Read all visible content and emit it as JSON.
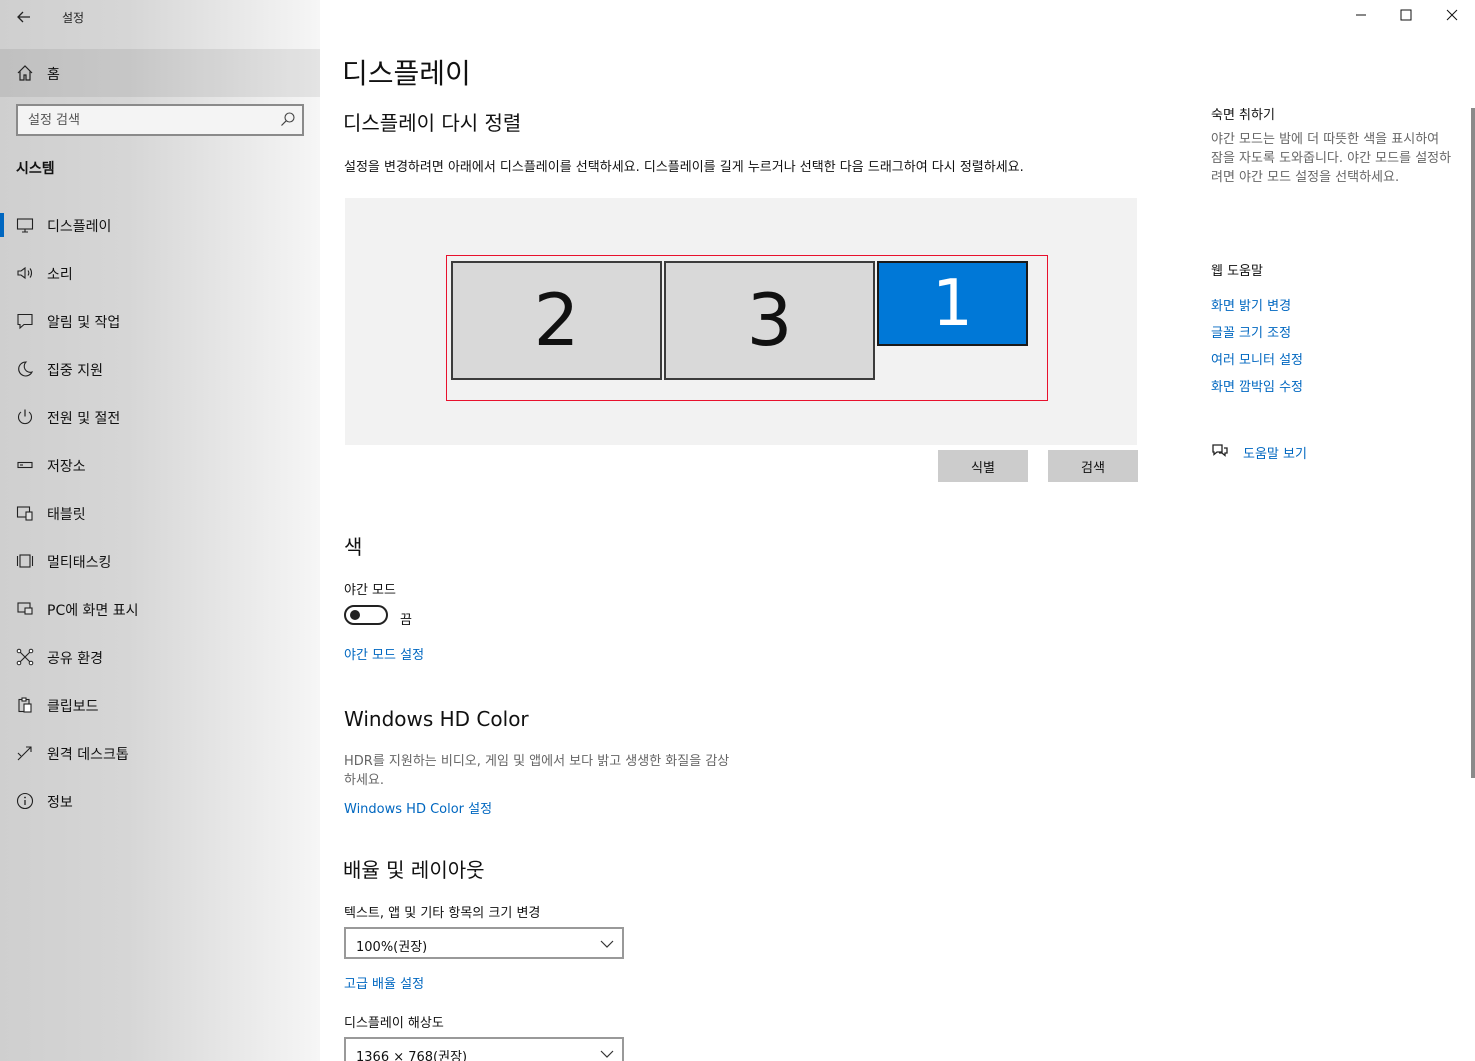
{
  "window": {
    "app_title": "설정",
    "back_icon": "back-arrow-icon",
    "controls": {
      "minimize": "—",
      "maximize": "☐",
      "close": "✕"
    }
  },
  "sidebar": {
    "home_label": "홈",
    "search_placeholder": "설정 검색",
    "section_label": "시스템",
    "items": [
      {
        "label": "디스플레이",
        "icon": "monitor-icon",
        "active": true
      },
      {
        "label": "소리",
        "icon": "speaker-icon"
      },
      {
        "label": "알림 및 작업",
        "icon": "notification-icon"
      },
      {
        "label": "집중 지원",
        "icon": "moon-icon"
      },
      {
        "label": "전원 및 절전",
        "icon": "power-icon"
      },
      {
        "label": "저장소",
        "icon": "storage-icon"
      },
      {
        "label": "태블릿",
        "icon": "tablet-icon"
      },
      {
        "label": "멀티태스킹",
        "icon": "multitasking-icon"
      },
      {
        "label": "PC에 화면 표시",
        "icon": "project-icon"
      },
      {
        "label": "공유 환경",
        "icon": "share-icon"
      },
      {
        "label": "클립보드",
        "icon": "clipboard-icon"
      },
      {
        "label": "원격 데스크톱",
        "icon": "remote-desktop-icon"
      },
      {
        "label": "정보",
        "icon": "info-icon"
      }
    ]
  },
  "main": {
    "page_title": "디스플레이",
    "rearrange": {
      "heading": "디스플레이 다시 정렬",
      "description": "설정을 변경하려면 아래에서 디스플레이를 선택하세요. 디스플레이를 길게 누르거나 선택한 다음 드래그하여 다시 정렬하세요.",
      "monitors": [
        {
          "number": "2",
          "selected": false
        },
        {
          "number": "3",
          "selected": false
        },
        {
          "number": "1",
          "selected": true
        }
      ],
      "identify_label": "식별",
      "detect_label": "검색"
    },
    "color": {
      "heading": "색",
      "night_light_label": "야간 모드",
      "night_light_state": "끔",
      "night_light_on": false,
      "night_light_settings_link": "야간 모드 설정"
    },
    "hdr": {
      "heading": "Windows HD Color",
      "description_line1": "HDR를 지원하는 비디오, 게임 및 앱에서 보다 밝고 생생한 화질을 감상",
      "description_line2": "하세요.",
      "settings_link": "Windows HD Color 설정"
    },
    "scale": {
      "heading": "배율 및 레이아웃",
      "size_label": "텍스트, 앱 및 기타 항목의 크기 변경",
      "size_value": "100%(권장)",
      "advanced_link": "고급 배율 설정",
      "resolution_label": "디스플레이 해상도",
      "resolution_value": "1366 × 768(권장)"
    }
  },
  "right": {
    "sleep_title": "숙면 취하기",
    "sleep_text": "야간 모드는 밤에 더 따뜻한 색을 표시하여 잠을 자도록 도와줍니다. 야간 모드를 설정하려면 야간 모드 설정을 선택하세요.",
    "web_help_title": "웹 도움말",
    "links": [
      "화면 밝기 변경",
      "글꼴 크기 조정",
      "여러 모니터 설정",
      "화면 깜박임 수정"
    ],
    "get_help": "도움말 보기"
  },
  "colors": {
    "accent": "#0067c0",
    "selected_monitor": "#0078d7",
    "selection_border": "#e8112d"
  }
}
